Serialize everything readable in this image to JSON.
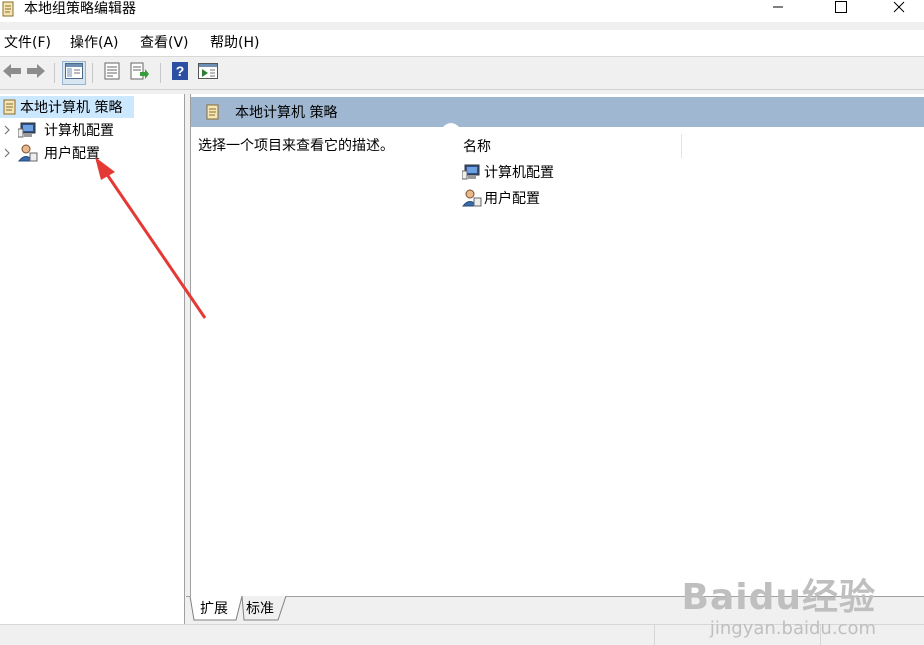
{
  "window": {
    "title": "本地组策略编辑器",
    "icon": "policy-scroll-icon"
  },
  "menu": [
    "文件(F)",
    "操作(A)",
    "查看(V)",
    "帮助(H)"
  ],
  "toolbar": {
    "icons": [
      "back-arrow-icon",
      "forward-arrow-icon",
      "show-hide-tree-icon",
      "properties-icon",
      "export-list-icon",
      "help-icon",
      "action-pane-icon"
    ]
  },
  "tree": {
    "root": "本地计算机 策略",
    "children": [
      {
        "label": "计算机配置",
        "icon": "computer-config-icon"
      },
      {
        "label": "用户配置",
        "icon": "user-config-icon"
      }
    ]
  },
  "details": {
    "header": "本地计算机 策略",
    "description": "选择一个项目来查看它的描述。",
    "column": "名称",
    "items": [
      {
        "label": "计算机配置",
        "icon": "computer-config-icon"
      },
      {
        "label": "用户配置",
        "icon": "user-config-icon"
      }
    ]
  },
  "tabs": [
    "扩展",
    "标准"
  ],
  "watermark": {
    "logo": "Baidu经验",
    "url": "jingyan.baidu.com"
  },
  "colors": {
    "header_bar": "#9fb7d0",
    "selection": "#cce8ff",
    "annotation_arrow": "#e53935"
  }
}
